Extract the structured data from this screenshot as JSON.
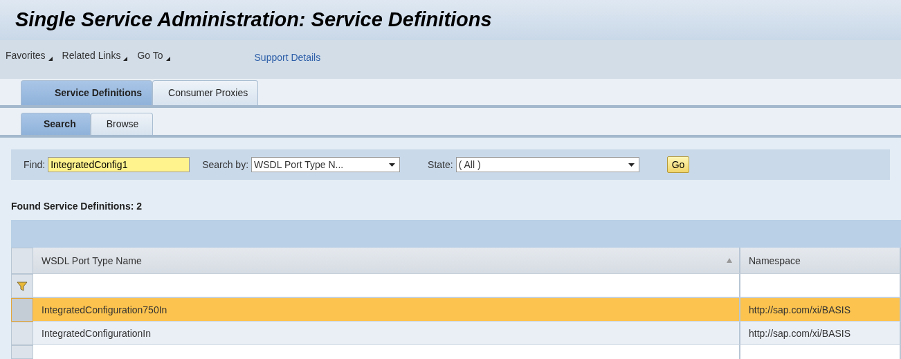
{
  "window": {
    "title": "Single Service Administration: Service Definitions"
  },
  "menu": [
    {
      "label": "Favorites",
      "kind": "dropdown"
    },
    {
      "label": "Related Links",
      "kind": "dropdown"
    },
    {
      "label": "Go To",
      "kind": "dropdown"
    },
    {
      "label": "Support Details",
      "kind": "link"
    }
  ],
  "tabs": [
    {
      "label": "Service Definitions",
      "selected": true
    },
    {
      "label": "Consumer Proxies",
      "selected": false
    }
  ],
  "subtabs": [
    {
      "label": "Search",
      "selected": true
    },
    {
      "label": "Browse",
      "selected": false
    }
  ],
  "search": {
    "find_label": "Find:",
    "find_value": "IntegratedConfig1",
    "search_by_label": "Search by:",
    "search_by_value": "WSDL Port Type N...",
    "state_label": "State:",
    "state_value": "( All )",
    "go": "Go"
  },
  "table": {
    "title": "Found Service Definitions: 2",
    "columns": [
      {
        "label": "WSDL Port Type Name",
        "sorted": true
      },
      {
        "label": "Namespace",
        "sorted": false
      }
    ],
    "rows": [
      {
        "cells": [
          "IntegratedConfiguration750In",
          "http://sap.com/xi/BASIS"
        ],
        "selected": true
      },
      {
        "cells": [
          "IntegratedConfigurationIn",
          "http://sap.com/xi/BASIS"
        ],
        "selected": false
      }
    ]
  }
}
